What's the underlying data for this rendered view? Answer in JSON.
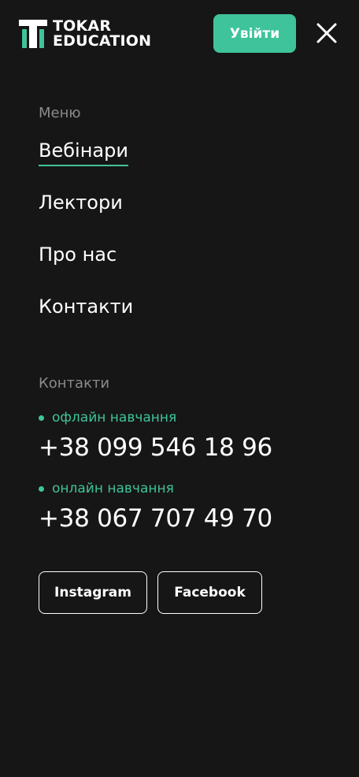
{
  "header": {
    "logo_line1": "TOKAR",
    "logo_line2": "EDUCATION",
    "login_label": "Увійти",
    "close_icon": "close-icon"
  },
  "menu": {
    "heading": "Меню",
    "items": [
      {
        "label": "Вебінари",
        "active": true
      },
      {
        "label": "Лектори",
        "active": false
      },
      {
        "label": "Про нас",
        "active": false
      },
      {
        "label": "Контакти",
        "active": false
      }
    ]
  },
  "contacts": {
    "heading": "Контакти",
    "entries": [
      {
        "tag": "офлайн навчання",
        "phone": "+38 099 546 18 96"
      },
      {
        "tag": "онлайн навчання",
        "phone": "+38 067 707 49 70"
      }
    ]
  },
  "social": {
    "instagram_label": "Instagram",
    "facebook_label": "Facebook"
  },
  "colors": {
    "background": "#161616",
    "accent": "#3fc39a",
    "muted": "#8a8a8a",
    "text": "#ffffff"
  }
}
